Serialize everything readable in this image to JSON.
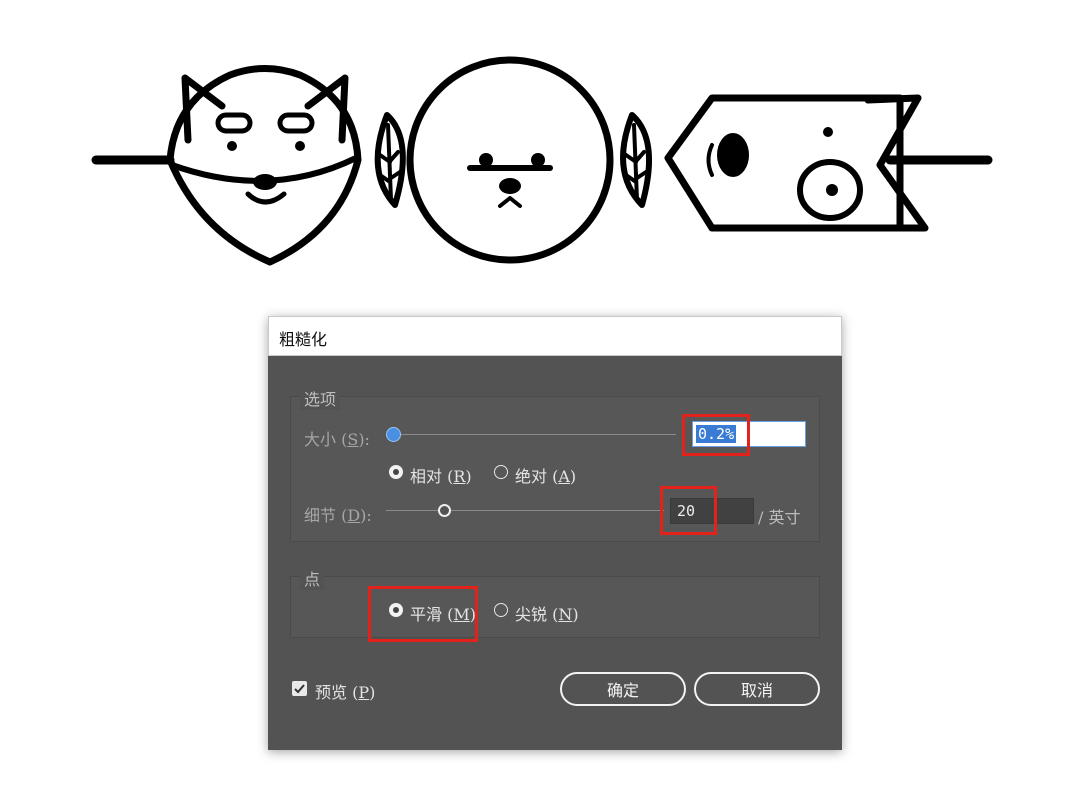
{
  "dialog": {
    "title": "粗糙化",
    "options_group": {
      "label": "选项",
      "size": {
        "label": "大小 (",
        "key": "S",
        "suffix": "):",
        "value": "0.2%"
      },
      "mode_relative": {
        "label": "相对 (",
        "key": "R",
        "suffix": ")",
        "selected": true
      },
      "mode_absolute": {
        "label": "绝对 (",
        "key": "A",
        "suffix": ")",
        "selected": false
      },
      "detail": {
        "label": "细节 (",
        "key": "D",
        "suffix": "):",
        "value": "20",
        "unit": "/ 英寸"
      }
    },
    "points_group": {
      "label": "点",
      "smooth": {
        "label": "平滑 (",
        "key": "M",
        "suffix": ")",
        "selected": true
      },
      "corner": {
        "label": "尖锐 (",
        "key": "N",
        "suffix": ")",
        "selected": false
      }
    },
    "preview": {
      "label": "预览 (",
      "key": "P",
      "suffix": ")",
      "checked": true
    },
    "ok_label": "确定",
    "cancel_label": "取消"
  },
  "colors": {
    "dialog_bg": "#535353",
    "accent_blue": "#3a7bd5",
    "highlight_red": "#e3221c"
  }
}
